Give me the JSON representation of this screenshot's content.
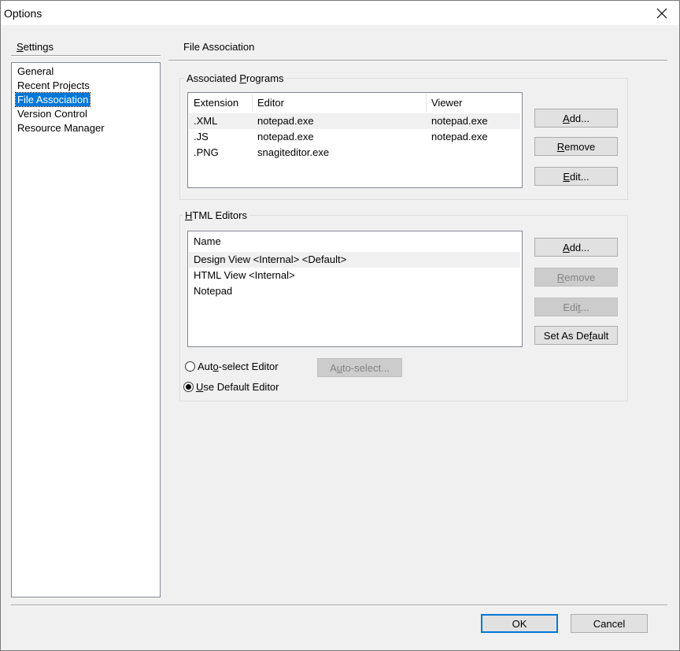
{
  "window": {
    "title": "Options"
  },
  "settings": {
    "label": "Settings",
    "items": [
      "General",
      "Recent Projects",
      "File Association",
      "Version Control",
      "Resource Manager"
    ],
    "selected_index": 2
  },
  "panel": {
    "title": "File Association"
  },
  "associated_programs": {
    "group_label": "Associated Programs",
    "columns": [
      "Extension",
      "Editor",
      "Viewer"
    ],
    "rows": [
      {
        "extension": ".XML",
        "editor": "notepad.exe",
        "viewer": "notepad.exe"
      },
      {
        "extension": ".JS",
        "editor": "notepad.exe",
        "viewer": "notepad.exe"
      },
      {
        "extension": ".PNG",
        "editor": "snagiteditor.exe",
        "viewer": ""
      }
    ],
    "buttons": {
      "add": "Add...",
      "remove": "Remove",
      "edit": "Edit..."
    }
  },
  "html_editors": {
    "group_label": "HTML Editors",
    "columns": [
      "Name"
    ],
    "rows": [
      "Design View <Internal> <Default>",
      "HTML View <Internal>",
      "Notepad"
    ],
    "buttons": {
      "add": "Add...",
      "remove": "Remove",
      "edit": "Edit...",
      "set_default": "Set As Default"
    },
    "radio_auto": "Auto-select Editor",
    "radio_default": "Use Default Editor",
    "selected_radio": "default",
    "auto_select_button": "Auto-select..."
  },
  "footer": {
    "ok": "OK",
    "cancel": "Cancel"
  },
  "icons": {
    "close": "close-icon"
  }
}
